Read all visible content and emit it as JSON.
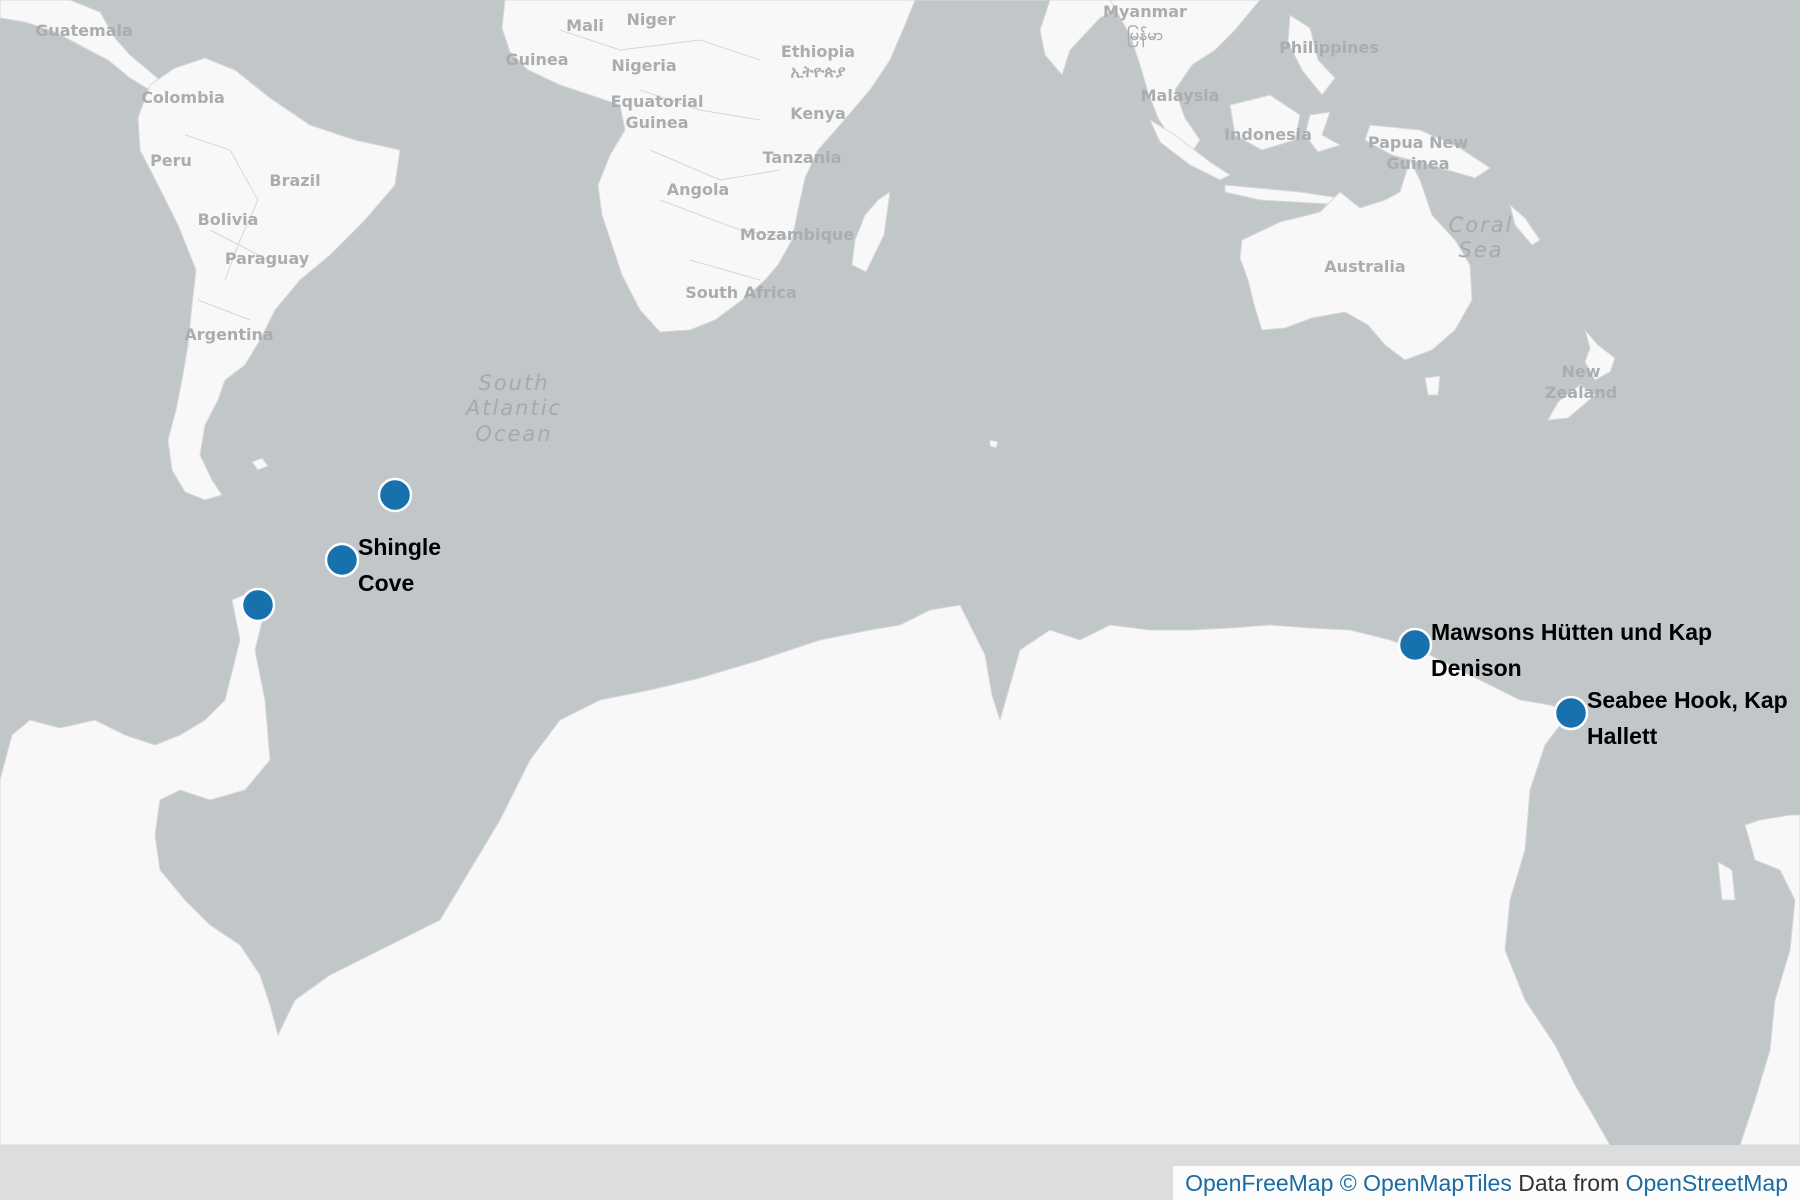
{
  "map": {
    "colors": {
      "water": "#c1c6c8",
      "land": "#f8f8f8",
      "marker": "#1771ad",
      "attribution_link": "#1a6ba3"
    },
    "country_labels": [
      {
        "name": "guatemala",
        "text": "Guatemala"
      },
      {
        "name": "mali",
        "text": "Mali"
      },
      {
        "name": "niger",
        "text": "Niger"
      },
      {
        "name": "guinea",
        "text": "Guinea"
      },
      {
        "name": "nigeria",
        "text": "Nigeria"
      },
      {
        "name": "ethiopia",
        "text": "Ethiopia"
      },
      {
        "name": "ethiopia-native",
        "text": "ኢትዮጵያ"
      },
      {
        "name": "myanmar",
        "text": "Myanmar"
      },
      {
        "name": "myanmar-native",
        "text": "မြန်မာ"
      },
      {
        "name": "philippines",
        "text": "Philippines"
      },
      {
        "name": "colombia",
        "text": "Colombia"
      },
      {
        "name": "equatorial-guinea-1",
        "text": "Equatorial"
      },
      {
        "name": "equatorial-guinea-2",
        "text": "Guinea"
      },
      {
        "name": "kenya",
        "text": "Kenya"
      },
      {
        "name": "malaysia",
        "text": "Malaysia"
      },
      {
        "name": "indonesia",
        "text": "Indonesia"
      },
      {
        "name": "papua-new-guinea-1",
        "text": "Papua New"
      },
      {
        "name": "papua-new-guinea-2",
        "text": "Guinea"
      },
      {
        "name": "peru",
        "text": "Peru"
      },
      {
        "name": "brazil",
        "text": "Brazil"
      },
      {
        "name": "tanzania",
        "text": "Tanzania"
      },
      {
        "name": "angola",
        "text": "Angola"
      },
      {
        "name": "bolivia",
        "text": "Bolivia"
      },
      {
        "name": "mozambique",
        "text": "Mozambique"
      },
      {
        "name": "paraguay",
        "text": "Paraguay"
      },
      {
        "name": "australia",
        "text": "Australia"
      },
      {
        "name": "south-africa",
        "text": "South Africa"
      },
      {
        "name": "argentina",
        "text": "Argentina"
      },
      {
        "name": "new-zealand-1",
        "text": "New"
      },
      {
        "name": "new-zealand-2",
        "text": "Zealand"
      }
    ],
    "ocean_labels": [
      {
        "name": "coral-sea-1",
        "text": "Coral"
      },
      {
        "name": "coral-sea-2",
        "text": "Sea"
      },
      {
        "name": "south-atlantic-1",
        "text": "South"
      },
      {
        "name": "south-atlantic-2",
        "text": "Atlantic"
      },
      {
        "name": "south-atlantic-3",
        "text": "Ocean"
      }
    ],
    "markers": [
      {
        "name": "marker-unlabeled-north",
        "label": []
      },
      {
        "name": "marker-shingle-cove",
        "label": [
          "Shingle",
          "Cove"
        ]
      },
      {
        "name": "marker-unlabeled-peninsula",
        "label": []
      },
      {
        "name": "marker-mawsons-huetten",
        "label": [
          "Mawsons Hütten und Kap",
          "Denison"
        ]
      },
      {
        "name": "marker-seabee-hook",
        "label": [
          "Seabee Hook, Kap",
          "Hallett"
        ]
      }
    ]
  },
  "attribution": {
    "openfreemap": "OpenFreeMap",
    "openmaptiles": "© OpenMapTiles",
    "data_from": "Data from",
    "openstreetmap": "OpenStreetMap"
  }
}
